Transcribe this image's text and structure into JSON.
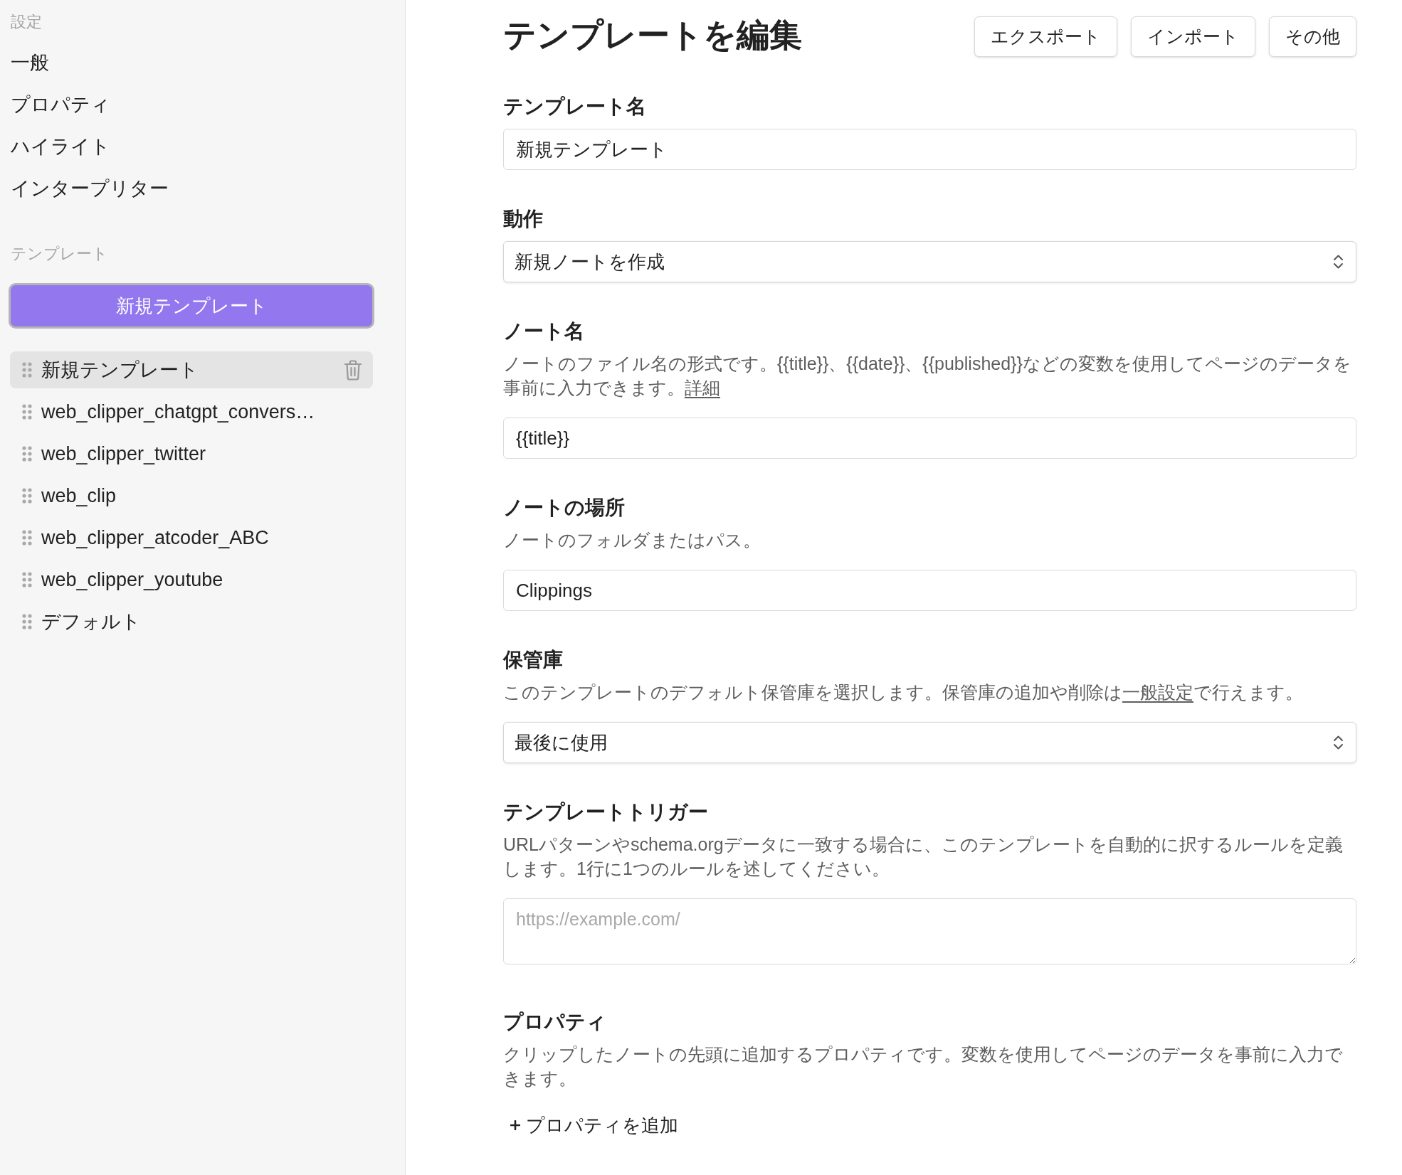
{
  "sidebar": {
    "settings_heading": "設定",
    "settings_items": [
      {
        "label": "一般"
      },
      {
        "label": "プロパティ"
      },
      {
        "label": "ハイライト"
      },
      {
        "label": "インタープリター"
      }
    ],
    "templates_heading": "テンプレート",
    "new_template_button": "新規テンプレート",
    "templates": [
      {
        "label": "新規テンプレート",
        "selected": true
      },
      {
        "label": "web_clipper_chatgpt_convers…",
        "selected": false
      },
      {
        "label": "web_clipper_twitter",
        "selected": false
      },
      {
        "label": "web_clip",
        "selected": false
      },
      {
        "label": "web_clipper_atcoder_ABC",
        "selected": false
      },
      {
        "label": "web_clipper_youtube",
        "selected": false
      },
      {
        "label": "デフォルト",
        "selected": false
      }
    ]
  },
  "main": {
    "title": "テンプレートを編集",
    "header_buttons": [
      "エクスポート",
      "インポート",
      "その他"
    ],
    "fields": [
      {
        "kind": "input",
        "label": "テンプレート名",
        "value": "新規テンプレート"
      },
      {
        "kind": "select",
        "label": "動作",
        "value": "新規ノートを作成"
      },
      {
        "kind": "input",
        "label": "ノート名",
        "description": [
          {
            "kind": "text",
            "text": "ノートのファイル名の形式です。{{title}}、{{date}}、{{published}}などの変数を使用してページのデータを事前に入力できます。"
          },
          {
            "kind": "link",
            "text": "詳細"
          }
        ],
        "value": "{{title}}"
      },
      {
        "kind": "input",
        "label": "ノートの場所",
        "description": [
          {
            "kind": "text",
            "text": "ノートのフォルダまたはパス。"
          }
        ],
        "value": "Clippings"
      },
      {
        "kind": "select",
        "label": "保管庫",
        "description": [
          {
            "kind": "text",
            "text": "このテンプレートのデフォルト保管庫を選択します。保管庫の追加や削除は"
          },
          {
            "kind": "link",
            "text": "一般設定"
          },
          {
            "kind": "text",
            "text": "で行えます。"
          }
        ],
        "value": "最後に使用"
      },
      {
        "kind": "textarea",
        "label": "テンプレートトリガー",
        "description": [
          {
            "kind": "text",
            "text": "URLパターンやschema.orgデータに一致する場合に、このテンプレートを自動的に択するルールを定義します。1行に1つのルールを述してください。"
          }
        ],
        "placeholder": "https://example.com/"
      },
      {
        "kind": "properties",
        "label": "プロパティ",
        "description": [
          {
            "kind": "text",
            "text": "クリップしたノートの先頭に追加するプロパティです。変数を使用してページのデータを事前に入力できます。"
          }
        ],
        "add_button": "プロパティを追加"
      }
    ]
  }
}
